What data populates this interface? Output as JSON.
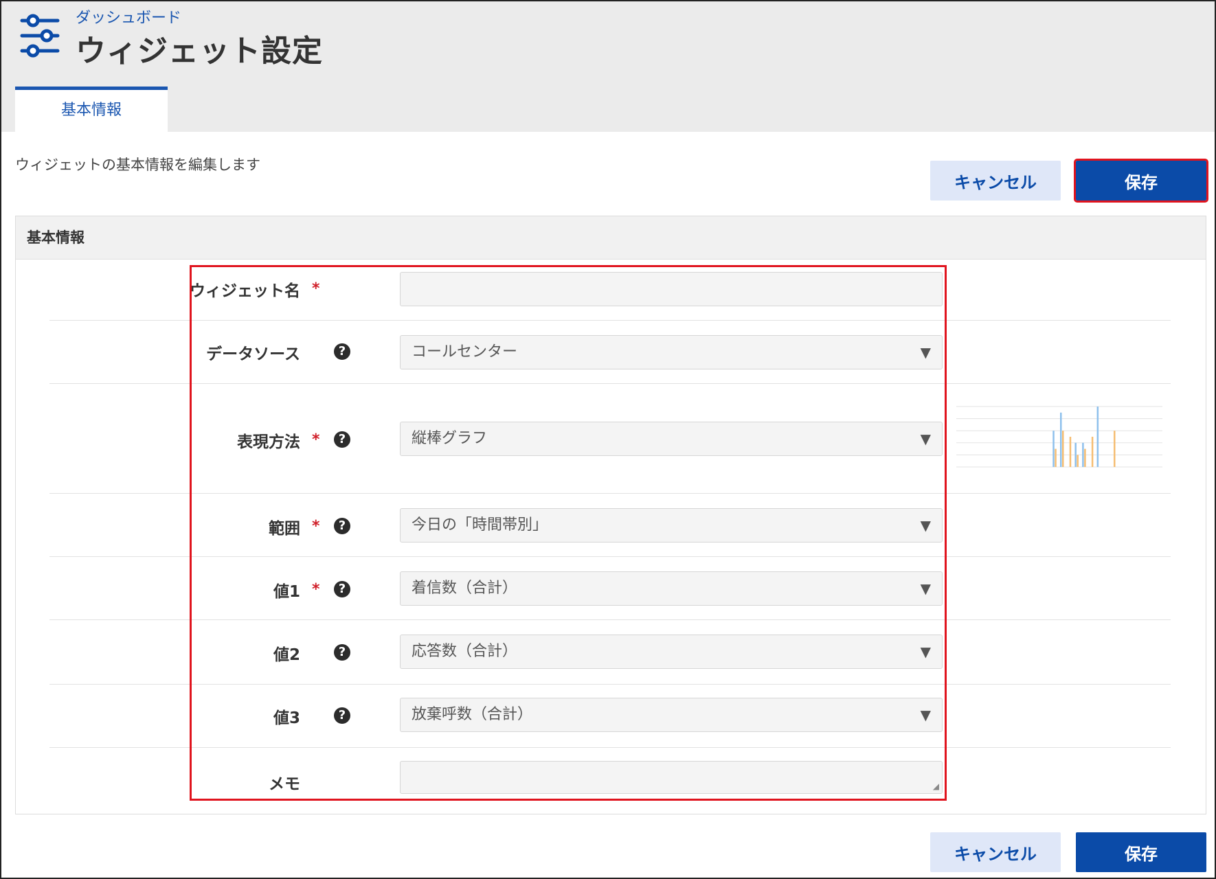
{
  "header": {
    "breadcrumb": "ダッシュボード",
    "title": "ウィジェット設定",
    "icon": "sliders-icon",
    "tab_label": "基本情報"
  },
  "colors": {
    "accent": "#0b4ba8",
    "highlight": "#e0141e",
    "required": "#d0202a"
  },
  "description": "ウィジェットの基本情報を編集します",
  "buttons": {
    "cancel": "キャンセル",
    "save": "保存"
  },
  "panel": {
    "title": "基本情報"
  },
  "form": {
    "required_mark": "*",
    "help_mark": "?",
    "widget_name": {
      "label": "ウィジェット名",
      "value": ""
    },
    "data_source": {
      "label": "データソース",
      "value": "コールセンター"
    },
    "display_method": {
      "label": "表現方法",
      "value": "縦棒グラフ"
    },
    "range": {
      "label": "範囲",
      "value": "今日の「時間帯別」"
    },
    "value1": {
      "label": "値1",
      "value": "着信数（合計）"
    },
    "value2": {
      "label": "値2",
      "value": "応答数（合計）"
    },
    "value3": {
      "label": "値3",
      "value": "放棄呼数（合計）"
    },
    "memo": {
      "label": "メモ",
      "value": ""
    }
  },
  "preview_chart": {
    "blue": [
      0,
      0,
      0,
      0,
      0,
      0,
      0,
      0,
      0,
      0,
      0,
      0,
      0,
      6,
      9,
      0,
      4,
      4,
      0,
      10,
      0,
      0,
      0,
      0,
      0,
      0,
      0,
      0
    ],
    "orange": [
      0,
      0,
      0,
      0,
      0,
      0,
      0,
      0,
      0,
      0,
      0,
      0,
      0,
      3,
      6,
      5,
      2,
      3,
      5,
      0,
      0,
      6,
      0,
      0,
      0,
      0,
      0,
      0
    ]
  }
}
